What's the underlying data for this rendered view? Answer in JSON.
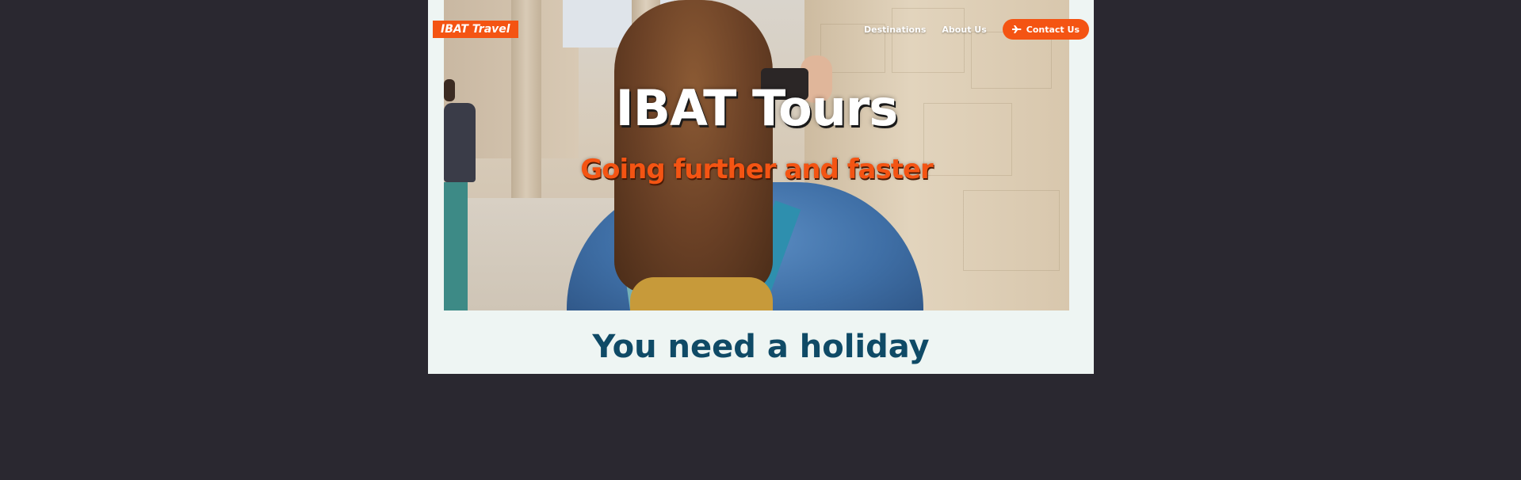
{
  "header": {
    "brand": "IBAT Travel",
    "nav": [
      {
        "label": "Destinations"
      },
      {
        "label": "About Us"
      }
    ],
    "contact_button": {
      "label": "Contact Us",
      "icon": "plane-icon"
    }
  },
  "hero": {
    "title": "IBAT Tours",
    "subtitle": "Going further and faster"
  },
  "section": {
    "heading": "You need a holiday"
  },
  "colors": {
    "accent": "#f45413",
    "heading": "#0f4a66",
    "page_bg": "#eef5f3",
    "outer_bg": "#2a2830"
  }
}
